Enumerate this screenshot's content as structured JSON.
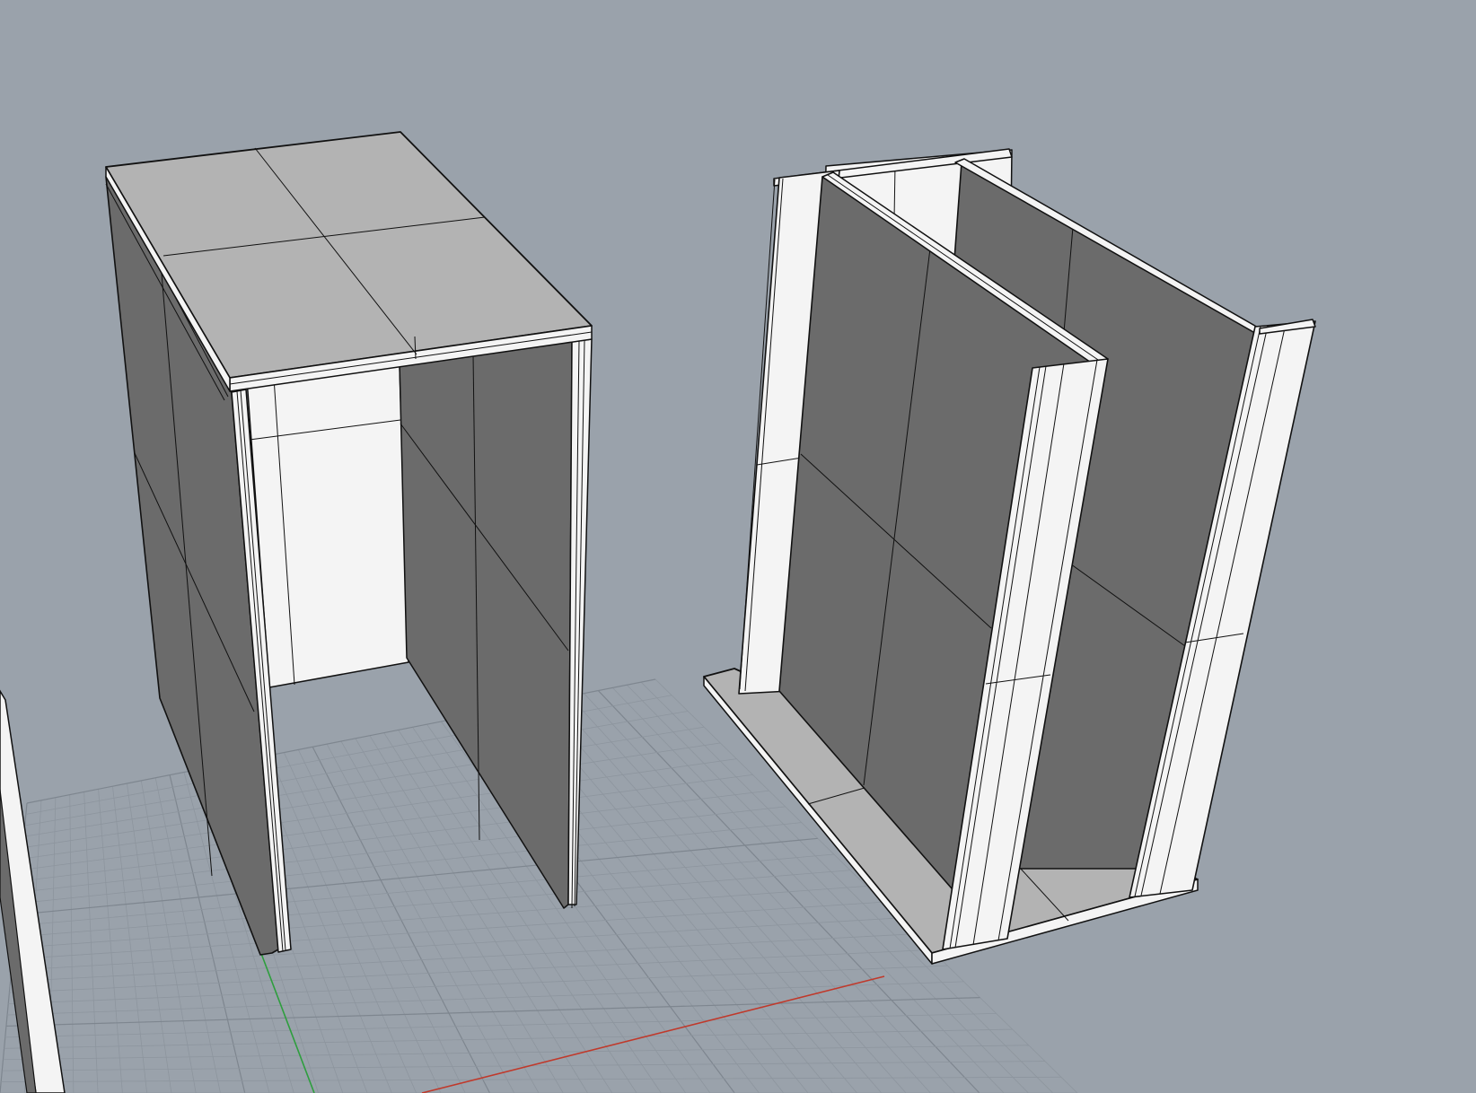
{
  "viewport": {
    "label": "",
    "background_color": "#9aa2ab"
  },
  "scene": {
    "objects": [
      {
        "kind": "open-cabinet-carcass",
        "panels": [
          "top-panel",
          "left-side-panel",
          "right-side-panel",
          "back-panel"
        ]
      },
      {
        "kind": "divider-assembly",
        "panels": [
          "base-panel",
          "back-panel",
          "divider-panel",
          "divider-panel",
          "end-panel",
          "end-panel"
        ]
      }
    ]
  },
  "grid": {
    "visible": true,
    "x_axis_color": "#c0392b",
    "y_axis_color": "#2e9e3e"
  },
  "colors": {
    "panel_light": "#b3b3b3",
    "panel_dark": "#6b6b6b",
    "panel_white": "#f4f4f4",
    "edge": "#111111"
  }
}
